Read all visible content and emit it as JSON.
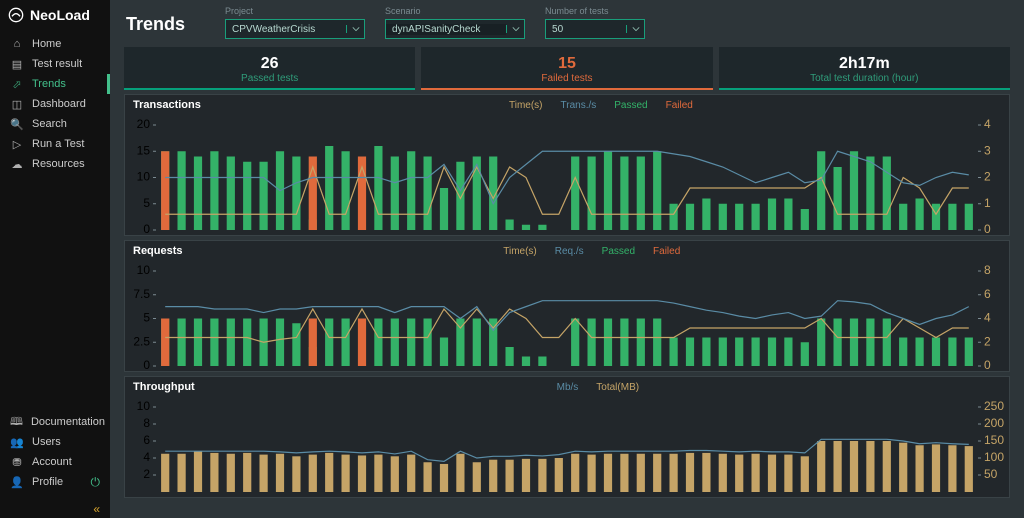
{
  "brand": "NeoLoad",
  "nav": {
    "top": [
      "Home",
      "Test result",
      "Trends",
      "Dashboard",
      "Search",
      "Run a Test",
      "Resources"
    ],
    "bottom": [
      "Documentation",
      "Users",
      "Account",
      "Profile"
    ],
    "active": "Trends"
  },
  "page": {
    "title": "Trends"
  },
  "filters": {
    "project": {
      "label": "Project",
      "value": "CPVWeatherCrisis"
    },
    "scenario": {
      "label": "Scenario",
      "value": "dynAPISanityCheck"
    },
    "count": {
      "label": "Number of tests",
      "value": "50"
    }
  },
  "summary": {
    "passed": {
      "value": "26",
      "label": "Passed tests"
    },
    "failed": {
      "value": "15",
      "label": "Failed tests"
    },
    "duration": {
      "value": "2h17m",
      "label": "Total test duration (hour)"
    }
  },
  "chart_data": [
    {
      "id": "transactions",
      "title": "Transactions",
      "type": "bar",
      "legend": [
        "Time(s)",
        "Trans./s",
        "Passed",
        "Failed"
      ],
      "yLeft": {
        "ticks": [
          0,
          5,
          10,
          15,
          20
        ],
        "max": 20
      },
      "yRight": {
        "ticks": [
          0,
          1,
          2,
          3,
          4
        ],
        "max": 4
      },
      "series": {
        "passed": [
          15,
          15,
          14,
          15,
          14,
          13,
          13,
          15,
          14,
          2,
          16,
          15,
          0,
          16,
          14,
          15,
          14,
          8,
          13,
          14,
          14,
          2,
          1,
          1,
          0,
          14,
          14,
          15,
          14,
          14,
          15,
          5,
          5,
          6,
          5,
          5,
          5,
          6,
          6,
          4,
          15,
          12,
          15,
          14,
          14,
          5,
          6,
          5,
          5,
          5
        ],
        "failed": [
          15,
          0,
          0,
          0,
          0,
          0,
          0,
          0,
          0,
          14,
          0,
          0,
          14,
          0,
          0,
          0,
          0,
          0,
          0,
          0,
          0,
          0,
          0,
          0,
          0,
          0,
          0,
          0,
          0,
          0,
          0,
          0,
          0,
          0,
          0,
          0,
          0,
          0,
          0,
          0,
          0,
          0,
          0,
          0,
          0,
          0,
          0,
          0,
          0,
          0
        ],
        "time": [
          3,
          3,
          3,
          3,
          3,
          3,
          3,
          3,
          3,
          12,
          3,
          3,
          12,
          3,
          3,
          3,
          3,
          12,
          6,
          12,
          6,
          12,
          10,
          3,
          3,
          10,
          3,
          3,
          3,
          3,
          3,
          3,
          8,
          8,
          8,
          8,
          8,
          8,
          8,
          8,
          10,
          3,
          3,
          3,
          3,
          10,
          8,
          3,
          8,
          8
        ],
        "blue": [
          2,
          2,
          2,
          2,
          2,
          2,
          2,
          1.5,
          1.8,
          2,
          2,
          2,
          2,
          2,
          1.8,
          2,
          2,
          2.5,
          1.5,
          2.5,
          1,
          2,
          2.5,
          3,
          3,
          3,
          3,
          3,
          3,
          3,
          3,
          2.9,
          2.8,
          2.6,
          2.4,
          2.1,
          1.8,
          2.0,
          2.2,
          1.8,
          1.9,
          3.0,
          2.8,
          2.6,
          2.2,
          1.8,
          1.7,
          2.0,
          2.2,
          2.1
        ]
      }
    },
    {
      "id": "requests",
      "title": "Requests",
      "type": "bar",
      "legend": [
        "Time(s)",
        "Req./s",
        "Passed",
        "Failed"
      ],
      "yLeft": {
        "ticks": [
          0,
          2.5,
          5,
          7.5,
          10
        ],
        "max": 10
      },
      "yRight": {
        "ticks": [
          0,
          2,
          4,
          6,
          8
        ],
        "max": 8
      },
      "series": {
        "passed": [
          5,
          5,
          5,
          5,
          5,
          5,
          5,
          5,
          4.5,
          2,
          5,
          5,
          0,
          5,
          5,
          5,
          5,
          3,
          5,
          5,
          5,
          2,
          1,
          1,
          0,
          5,
          5,
          5,
          5,
          5,
          5,
          3,
          3,
          3,
          3,
          3,
          3,
          3,
          3,
          2.5,
          5,
          5,
          5,
          5,
          5,
          3,
          3,
          3,
          3,
          3
        ],
        "failed": [
          5,
          0,
          0,
          0,
          0,
          0,
          0,
          0,
          0,
          5,
          0,
          0,
          5,
          0,
          0,
          0,
          0,
          0,
          0,
          0,
          0,
          0,
          0,
          0,
          0,
          0,
          0,
          0,
          0,
          0,
          0,
          0,
          0,
          0,
          0,
          0,
          0,
          0,
          0,
          0,
          0,
          0,
          0,
          0,
          0,
          0,
          0,
          0,
          0,
          0
        ],
        "time": [
          3,
          3,
          3,
          3,
          3,
          3,
          2.5,
          2.8,
          3,
          6,
          3,
          3,
          6,
          3,
          3,
          3,
          3,
          6,
          4,
          6,
          4,
          6,
          5,
          3,
          3,
          5,
          3,
          3,
          3,
          3,
          3,
          3,
          4,
          4,
          4,
          4,
          4,
          4,
          4,
          4,
          5,
          3,
          3,
          3,
          3,
          5,
          4,
          3,
          4,
          4
        ],
        "blue": [
          5,
          5,
          5,
          4.8,
          4.8,
          4.8,
          4.5,
          4.8,
          4.8,
          5,
          5,
          5,
          5,
          5,
          4.5,
          5,
          5,
          5,
          4,
          5,
          3,
          4.5,
          5,
          5.5,
          5.5,
          5.5,
          5.5,
          5.5,
          5.5,
          5.5,
          5.5,
          5.3,
          5,
          4.7,
          4.5,
          4.2,
          4,
          4.3,
          4.5,
          4,
          4.2,
          5.5,
          5.4,
          5.2,
          4.5,
          4,
          3.5,
          4,
          4.3,
          5
        ]
      }
    },
    {
      "id": "throughput",
      "title": "Throughput",
      "type": "bar",
      "legend": [
        "Mb/s",
        "Total(MB)"
      ],
      "yLeft": {
        "ticks": [
          2,
          4,
          6,
          8,
          10
        ],
        "max": 10
      },
      "yRight": {
        "ticks": [
          50,
          100,
          150,
          200,
          250
        ],
        "max": 250
      },
      "series": {
        "bars": [
          4.5,
          4.5,
          4.8,
          4.6,
          4.5,
          4.6,
          4.4,
          4.5,
          4.2,
          4.4,
          4.6,
          4.4,
          4.3,
          4.4,
          4.2,
          4.4,
          3.5,
          3.3,
          4.5,
          3.5,
          3.8,
          3.8,
          3.9,
          3.9,
          4.0,
          4.5,
          4.4,
          4.5,
          4.5,
          4.5,
          4.5,
          4.5,
          4.6,
          4.6,
          4.5,
          4.4,
          4.5,
          4.4,
          4.4,
          4.2,
          6.0,
          6.0,
          6.0,
          6.0,
          6.0,
          5.8,
          5.5,
          5.6,
          5.5,
          5.4
        ],
        "line": [
          120,
          120,
          120,
          120,
          120,
          120,
          120,
          118,
          115,
          118,
          120,
          118,
          115,
          118,
          112,
          120,
          95,
          90,
          120,
          100,
          105,
          105,
          108,
          106,
          110,
          120,
          118,
          120,
          120,
          120,
          120,
          120,
          122,
          122,
          120,
          118,
          120,
          118,
          118,
          115,
          155,
          155,
          155,
          155,
          155,
          150,
          142,
          145,
          142,
          140
        ]
      }
    }
  ]
}
